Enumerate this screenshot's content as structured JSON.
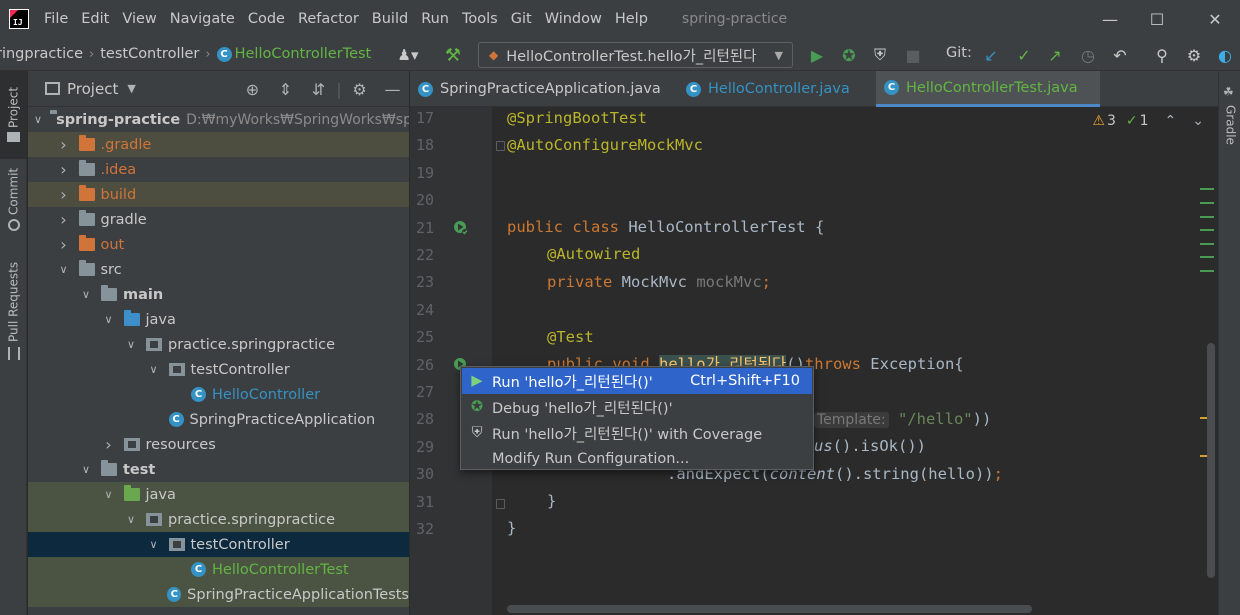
{
  "menubar": {
    "items": [
      "File",
      "Edit",
      "View",
      "Navigate",
      "Code",
      "Refactor",
      "Build",
      "Run",
      "Tools",
      "Git",
      "Window",
      "Help"
    ],
    "title": "spring-practice",
    "logo": "IJ"
  },
  "navbar": {
    "crumbs": [
      "ringpractice",
      "testController",
      "HelloControllerTest"
    ],
    "run_config": "HelloControllerTest.hello가_리턴된다",
    "git_label": "Git:"
  },
  "strips": {
    "left": [
      "Project",
      "Commit",
      "Pull Requests"
    ],
    "right": [
      "Gradle"
    ]
  },
  "project": {
    "title": "Project",
    "tree": [
      {
        "label": "spring-practice",
        "extra": "D:₩myWorks₩SpringWorks₩spr",
        "depth": 0,
        "arrow": "down",
        "icon": "module",
        "style": "bold"
      },
      {
        "label": ".gradle",
        "depth": 1,
        "arrow": "right",
        "icon": "folder-orange",
        "style": "orange",
        "hl": "yellow"
      },
      {
        "label": ".idea",
        "depth": 1,
        "arrow": "right",
        "icon": "folder-grey",
        "style": "orange"
      },
      {
        "label": "build",
        "depth": 1,
        "arrow": "right",
        "icon": "folder-orange",
        "style": "orange",
        "hl": "yellow"
      },
      {
        "label": "gradle",
        "depth": 1,
        "arrow": "right",
        "icon": "folder-grey",
        "style": "normal"
      },
      {
        "label": "out",
        "depth": 1,
        "arrow": "right",
        "icon": "folder-orange",
        "style": "orange"
      },
      {
        "label": "src",
        "depth": 1,
        "arrow": "down",
        "icon": "folder-grey",
        "style": "normal"
      },
      {
        "label": "main",
        "depth": 2,
        "arrow": "down",
        "icon": "folder-grey",
        "style": "bold"
      },
      {
        "label": "java",
        "depth": 3,
        "arrow": "down",
        "icon": "folder-blue",
        "style": "normal"
      },
      {
        "label": "practice.springpractice",
        "depth": 4,
        "arrow": "down",
        "icon": "package",
        "style": "normal"
      },
      {
        "label": "testController",
        "depth": 5,
        "arrow": "down",
        "icon": "package",
        "style": "normal"
      },
      {
        "label": "HelloController",
        "depth": 6,
        "arrow": "none",
        "icon": "class",
        "style": "blue"
      },
      {
        "label": "SpringPracticeApplication",
        "depth": 5,
        "arrow": "none",
        "icon": "class-run",
        "style": "normal"
      },
      {
        "label": "resources",
        "depth": 3,
        "arrow": "right",
        "icon": "package",
        "style": "normal"
      },
      {
        "label": "test",
        "depth": 2,
        "arrow": "down",
        "icon": "folder-grey",
        "style": "bold"
      },
      {
        "label": "java",
        "depth": 3,
        "arrow": "down",
        "icon": "folder-green",
        "style": "normal",
        "hl": "green"
      },
      {
        "label": "practice.springpractice",
        "depth": 4,
        "arrow": "down",
        "icon": "package",
        "style": "normal",
        "hl": "green"
      },
      {
        "label": "testController",
        "depth": 5,
        "arrow": "down",
        "icon": "package",
        "style": "normal",
        "hl": "selected"
      },
      {
        "label": "HelloControllerTest",
        "depth": 6,
        "arrow": "none",
        "icon": "class-test",
        "style": "green",
        "hl": "green"
      },
      {
        "label": "SpringPracticeApplicationTests",
        "depth": 5,
        "arrow": "none",
        "icon": "class-test",
        "style": "normal",
        "hl": "green"
      }
    ]
  },
  "tabs": [
    {
      "label": "SpringPracticeApplication.java",
      "color": "normal",
      "active": false
    },
    {
      "label": "HelloController.java",
      "color": "blue",
      "active": false
    },
    {
      "label": "HelloControllerTest.java",
      "color": "green",
      "active": true
    }
  ],
  "editor": {
    "warnings": "3",
    "checks": "1",
    "line_numbers": [
      "17",
      "18",
      "19",
      "20",
      "21",
      "22",
      "23",
      "24",
      "25",
      "26",
      "27",
      "28",
      "29",
      "30",
      "31",
      "32"
    ],
    "code": {
      "l17": "@SpringBootTest",
      "l18": "@AutoConfigureMockMvc",
      "l21_kw": "public class",
      "l21_rest": " HelloControllerTest {",
      "l22": "@Autowired",
      "l23_kw": "private",
      "l23_type": " MockMvc ",
      "l23_field": "mockMvc",
      "l23_end": ";",
      "l25": "@Test",
      "l26_kw": "public void ",
      "l26_name": "hello가_리턴된다",
      "l26_mid": "()",
      "l26_kw2": "throws",
      "l26_end": " Exception{",
      "l28_hint": "Template:",
      "l28_str": "\"/hello\"",
      "l28_end": "))",
      "l29_a": "us",
      "l29_b": "().isOk())",
      "l30_a": ".andExpect(",
      "l30_b": "content",
      "l30_c": "().string(hello))",
      "l30_d": ";",
      "l31": "}",
      "l32": "}"
    }
  },
  "popup": {
    "items": [
      {
        "label": "Run 'hello가_리턴된다()'",
        "shortcut": "Ctrl+Shift+F10",
        "icon": "run-icon",
        "selected": true
      },
      {
        "label": "Debug 'hello가_리턴된다()'",
        "shortcut": "",
        "icon": "debug-icon",
        "selected": false
      },
      {
        "label": "Run 'hello가_리턴된다()' with Coverage",
        "shortcut": "",
        "icon": "coverage-icon",
        "selected": false
      },
      {
        "label": "Modify Run Configuration...",
        "shortcut": "",
        "icon": "",
        "selected": false
      }
    ]
  },
  "colors": {
    "accent": "#4a88c7",
    "selection": "#2f65ca",
    "run_green": "#499c54"
  }
}
